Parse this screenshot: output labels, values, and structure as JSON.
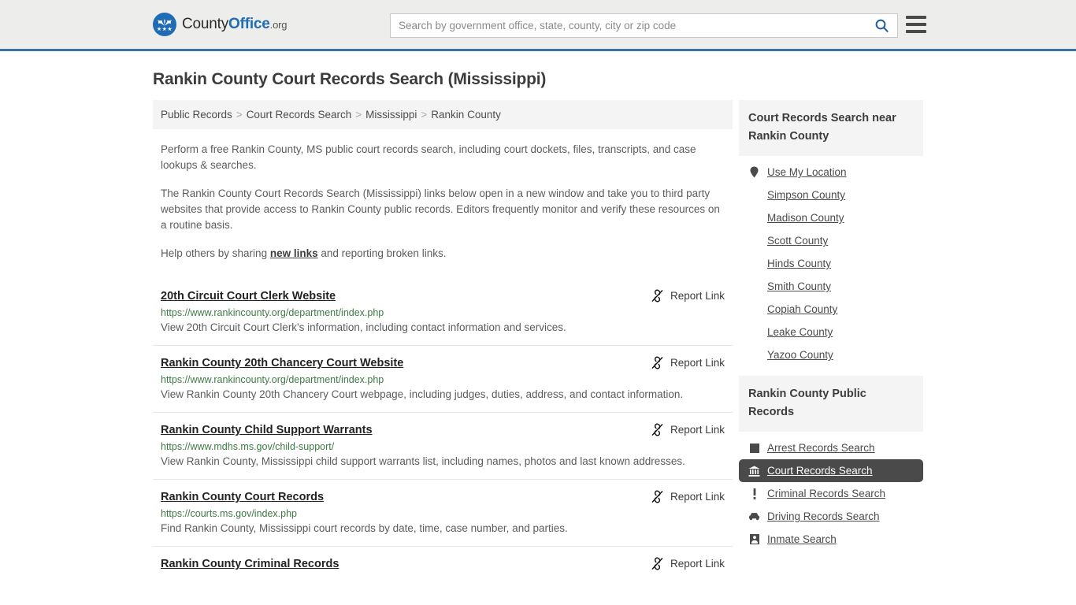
{
  "header": {
    "brand": {
      "part1": "County",
      "part2": "Office",
      "tld": ".org",
      "logo_icon": "eagle-seal-icon",
      "stars": "★★★"
    },
    "search": {
      "placeholder": "Search by government office, state, county, city or zip code",
      "value": "",
      "icon": "search-icon"
    },
    "menu_icon": "hamburger-menu-icon",
    "accent_color": "#3a72a8"
  },
  "page": {
    "title": "Rankin County Court Records Search (Mississippi)"
  },
  "breadcrumb": {
    "separator": ">",
    "items": [
      {
        "label": "Public Records"
      },
      {
        "label": "Court Records Search"
      },
      {
        "label": "Mississippi"
      },
      {
        "label": "Rankin County"
      }
    ]
  },
  "intro": {
    "p1": "Perform a free Rankin County, MS public court records search, including court dockets, files, transcripts, and case lookups & searches.",
    "p2": "The Rankin County Court Records Search (Mississippi) links below open in a new window and take you to third party websites that provide access to Rankin County public records. Editors frequently monitor and verify these resources on a routine basis.",
    "p3_before": "Help others by sharing ",
    "p3_link": "new links",
    "p3_after": " and reporting broken links."
  },
  "results": {
    "report_label": "Report Link",
    "report_icon": "broken-link-icon",
    "items": [
      {
        "title": "20th Circuit Court Clerk Website",
        "url": "https://www.rankincounty.org/department/index.php",
        "desc": "View 20th Circuit Court Clerk's information, including contact information and services."
      },
      {
        "title": "Rankin County 20th Chancery Court Website",
        "url": "https://www.rankincounty.org/department/index.php",
        "desc": "View Rankin County 20th Chancery Court webpage, including judges, duties, address, and contact information."
      },
      {
        "title": "Rankin County Child Support Warrants",
        "url": "https://www.mdhs.ms.gov/child-support/",
        "desc": "View Rankin County, Mississippi child support warrants list, including names, photos and last known addresses."
      },
      {
        "title": "Rankin County Court Records",
        "url": "https://courts.ms.gov/index.php",
        "desc": "Find Rankin County, Mississippi court records by date, time, case number, and parties."
      },
      {
        "title": "Rankin County Criminal Records",
        "url": "",
        "desc": ""
      }
    ]
  },
  "sidebar": {
    "nearby": {
      "heading": "Court Records Search near Rankin County",
      "items": [
        {
          "label": "Use My Location",
          "icon": "map-pin-icon",
          "active": false
        },
        {
          "label": "Simpson County",
          "icon": "",
          "active": false
        },
        {
          "label": "Madison County",
          "icon": "",
          "active": false
        },
        {
          "label": "Scott County",
          "icon": "",
          "active": false
        },
        {
          "label": "Hinds County",
          "icon": "",
          "active": false
        },
        {
          "label": "Smith County",
          "icon": "",
          "active": false
        },
        {
          "label": "Copiah County",
          "icon": "",
          "active": false
        },
        {
          "label": "Leake County",
          "icon": "",
          "active": false
        },
        {
          "label": "Yazoo County",
          "icon": "",
          "active": false
        }
      ]
    },
    "public_records": {
      "heading": "Rankin County Public Records",
      "items": [
        {
          "label": "Arrest Records Search",
          "icon": "fingerprint-card-icon",
          "active": false
        },
        {
          "label": "Court Records Search",
          "icon": "courthouse-icon",
          "active": true
        },
        {
          "label": "Criminal Records Search",
          "icon": "exclamation-icon",
          "active": false
        },
        {
          "label": "Driving Records Search",
          "icon": "car-icon",
          "active": false
        },
        {
          "label": "Inmate Search",
          "icon": "inmate-icon",
          "active": false
        }
      ]
    }
  }
}
